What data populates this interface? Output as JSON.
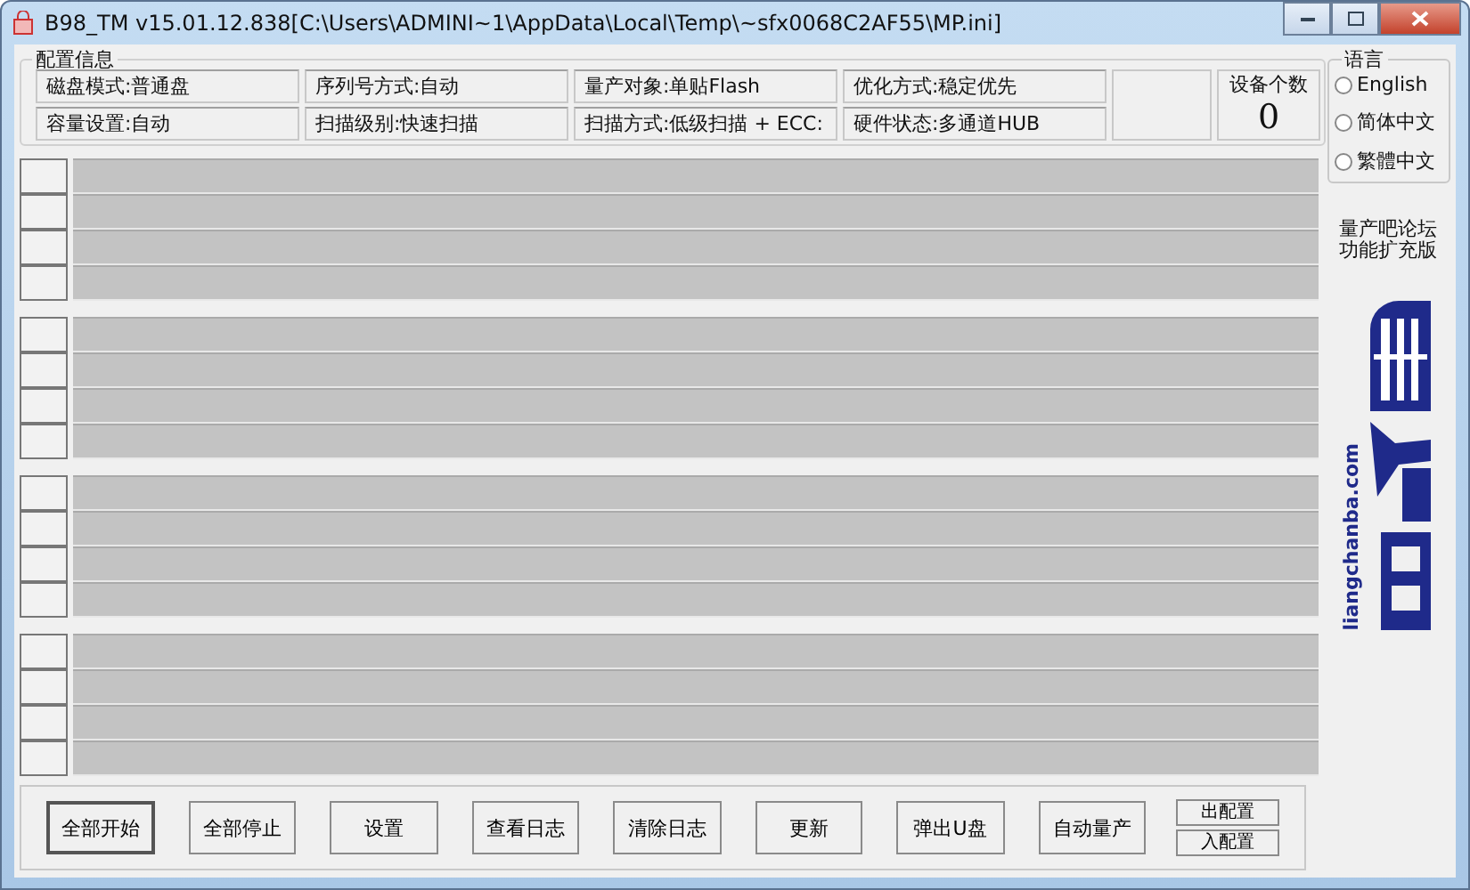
{
  "window": {
    "title": "B98_TM v15.01.12.838[C:\\Users\\ADMINI~1\\AppData\\Local\\Temp\\~sfx0068C2AF55\\MP.ini]"
  },
  "config": {
    "title": "配置信息",
    "cells": [
      "磁盘模式:普通盘",
      "序列号方式:自动",
      "量产对象:单贴Flash",
      "优化方式:稳定优先",
      "容量设置:自动",
      "扫描级别:快速扫描",
      "扫描方式:低级扫描 + ECC:",
      "硬件状态:多通道HUB"
    ],
    "device_count": {
      "label": "设备个数",
      "value": "0"
    }
  },
  "language": {
    "title": "语言",
    "options": [
      {
        "label": "English",
        "selected": false
      },
      {
        "label": "简体中文",
        "selected": false
      },
      {
        "label": "繁體中文",
        "selected": false
      }
    ]
  },
  "side_note": [
    "量产吧论坛",
    "功能扩充版"
  ],
  "logo_text": "liangchanba.com",
  "buttons": [
    "全部开始",
    "全部停止",
    "设置",
    "查看日志",
    "清除日志",
    "更新",
    "弹出U盘",
    "自动量产"
  ],
  "small_buttons": [
    "出配置",
    "入配置"
  ]
}
